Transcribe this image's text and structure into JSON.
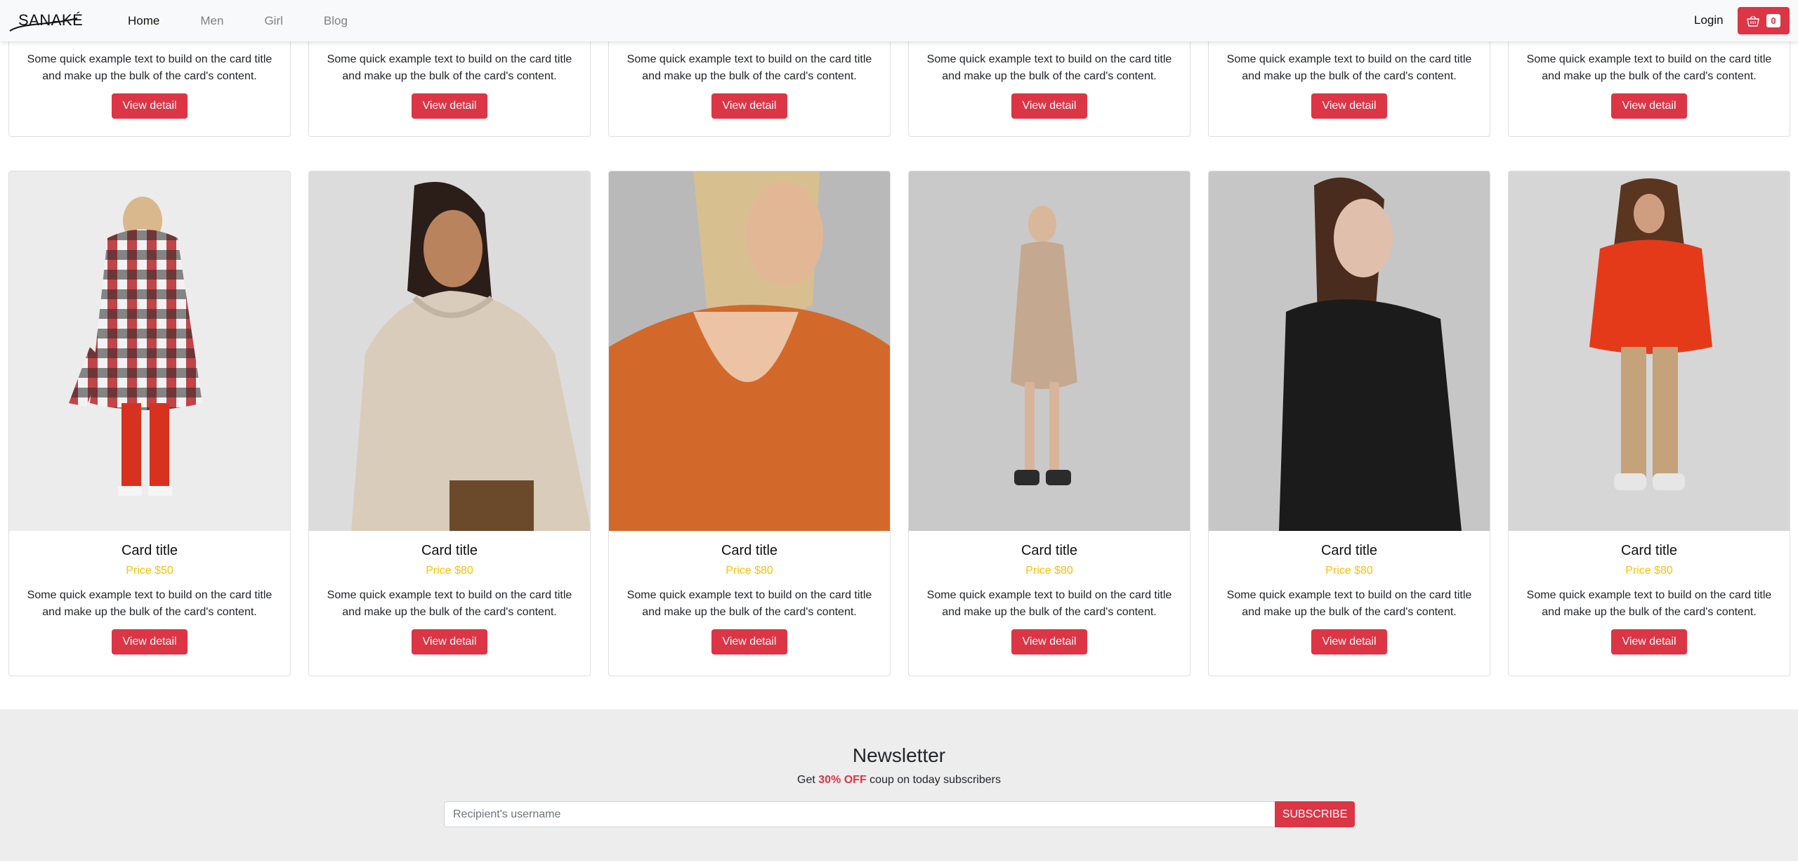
{
  "navbar": {
    "logo": "SANAKÉ",
    "links": [
      {
        "label": "Home",
        "active": true
      },
      {
        "label": "Men",
        "active": false
      },
      {
        "label": "Girl",
        "active": false
      },
      {
        "label": "Blog",
        "active": false
      }
    ],
    "login_label": "Login",
    "cart_count": "0",
    "cart_icon": "basket-icon"
  },
  "top_cards": [
    {
      "text": "Some quick example text to build on the card title and make up the bulk of the card's content.",
      "button": "View detail"
    },
    {
      "text": "Some quick example text to build on the card title and make up the bulk of the card's content.",
      "button": "View detail"
    },
    {
      "text": "Some quick example text to build on the card title and make up the bulk of the card's content.",
      "button": "View detail"
    },
    {
      "text": "Some quick example text to build on the card title and make up the bulk of the card's content.",
      "button": "View detail"
    },
    {
      "text": "Some quick example text to build on the card title and make up the bulk of the card's content.",
      "button": "View detail"
    },
    {
      "text": "Some quick example text to build on the card title and make up the bulk of the card's content.",
      "button": "View detail"
    }
  ],
  "cards": [
    {
      "title": "Card title",
      "price": "Price $50",
      "text": "Some quick example text to build on the card title and make up the bulk of the card's content.",
      "button": "View detail"
    },
    {
      "title": "Card title",
      "price": "Price $80",
      "text": "Some quick example text to build on the card title and make up the bulk of the card's content.",
      "button": "View detail"
    },
    {
      "title": "Card title",
      "price": "Price $80",
      "text": "Some quick example text to build on the card title and make up the bulk of the card's content.",
      "button": "View detail"
    },
    {
      "title": "Card title",
      "price": "Price $80",
      "text": "Some quick example text to build on the card title and make up the bulk of the card's content.",
      "button": "View detail"
    },
    {
      "title": "Card title",
      "price": "Price $80",
      "text": "Some quick example text to build on the card title and make up the bulk of the card's content.",
      "button": "View detail"
    },
    {
      "title": "Card title",
      "price": "Price $80",
      "text": "Some quick example text to build on the card title and make up the bulk of the card's content.",
      "button": "View detail"
    }
  ],
  "newsletter": {
    "title": "Newsletter",
    "sub_prefix": "Get ",
    "sub_highlight": "30% OFF",
    "sub_suffix": " coup on today subscribers",
    "placeholder": "Recipient's username",
    "button": "SUBSCRIBE"
  },
  "colors": {
    "accent": "#dc3545",
    "price": "#ffc107",
    "navbar_bg": "#f8f9fa",
    "newsletter_bg": "#ededed"
  }
}
